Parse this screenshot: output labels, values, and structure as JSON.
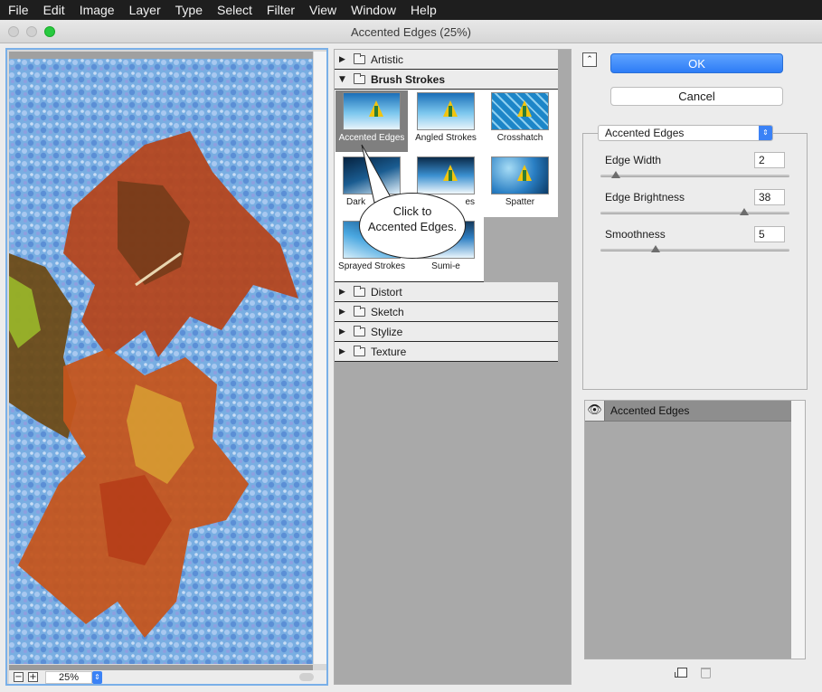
{
  "menubar": [
    "File",
    "Edit",
    "Image",
    "Layer",
    "Type",
    "Select",
    "Filter",
    "View",
    "Window",
    "Help"
  ],
  "window": {
    "title": "Accented Edges (25%)"
  },
  "preview": {
    "zoom": "25%",
    "zoom_out": "−",
    "zoom_in": "+"
  },
  "gallery": {
    "categories_top": [
      {
        "label": "Artistic",
        "arrow": "▶"
      },
      {
        "label": "Brush Strokes",
        "arrow": "▼"
      }
    ],
    "thumbs": [
      {
        "label": "Accented Edges",
        "selected": true
      },
      {
        "label": "Angled Strokes"
      },
      {
        "label": "Crosshatch"
      },
      {
        "label": "Dark"
      },
      {
        "label": "es"
      },
      {
        "label": "Spatter"
      },
      {
        "label": "Sprayed Strokes"
      },
      {
        "label": "Sumi-e"
      }
    ],
    "categories_bottom": [
      {
        "label": "Distort",
        "arrow": "▶"
      },
      {
        "label": "Sketch",
        "arrow": "▶"
      },
      {
        "label": "Stylize",
        "arrow": "▶"
      },
      {
        "label": "Texture",
        "arrow": "▶"
      }
    ]
  },
  "callout": {
    "line1": "Click to",
    "line2": "Accented Edges."
  },
  "buttons": {
    "ok": "OK",
    "cancel": "Cancel",
    "collapse": "⌃"
  },
  "filter_select": {
    "value": "Accented Edges",
    "arrow": "⇕"
  },
  "params": [
    {
      "label": "Edge Width",
      "value": "2",
      "level": 0.08
    },
    {
      "label": "Edge Brightness",
      "value": "38",
      "level": 0.76
    },
    {
      "label": "Smoothness",
      "value": "5",
      "level": 0.29
    }
  ],
  "layers": {
    "items": [
      {
        "name": "Accented Edges",
        "eye": "👁"
      }
    ]
  },
  "colors": {
    "accent": "#3b82f6",
    "ok_button": "#2d7cf6",
    "menubar": "#1e1e1e"
  }
}
